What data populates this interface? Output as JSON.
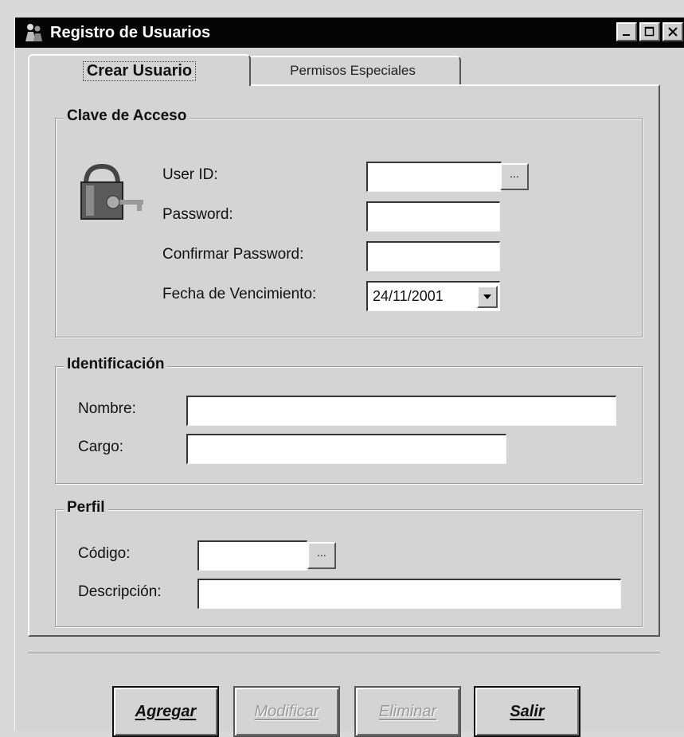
{
  "window": {
    "title": "Registro de Usuarios",
    "controls": [
      "minimize-icon",
      "maximize-icon",
      "close-icon"
    ]
  },
  "tabs": [
    {
      "label": "Crear Usuario",
      "active": true
    },
    {
      "label": "Permisos Especiales",
      "active": false
    }
  ],
  "clave": {
    "legend": "Clave de Acceso",
    "user_id_label": "User ID:",
    "user_id_value": "",
    "password_label": "Password:",
    "password_value": "",
    "confirm_label": "Confirmar Password:",
    "confirm_value": "",
    "fecha_label": "Fecha de Vencimiento:",
    "fecha_value": "24/11/2001",
    "lookup_label": "..."
  },
  "identificacion": {
    "legend": "Identificación",
    "nombre_label": "Nombre:",
    "nombre_value": "",
    "cargo_label": "Cargo:",
    "cargo_value": ""
  },
  "perfil": {
    "legend": "Perfil",
    "codigo_label": "Código:",
    "codigo_value": "",
    "descripcion_label": "Descripción:",
    "descripcion_value": "",
    "lookup_label": "..."
  },
  "buttons": {
    "agregar": "Agregar",
    "modificar": "Modificar",
    "eliminar": "Eliminar",
    "salir": "Salir"
  },
  "colors": {
    "titlebar": "#050505",
    "face": "#d4d4d4",
    "disabled_text": "#9a9a9a"
  }
}
